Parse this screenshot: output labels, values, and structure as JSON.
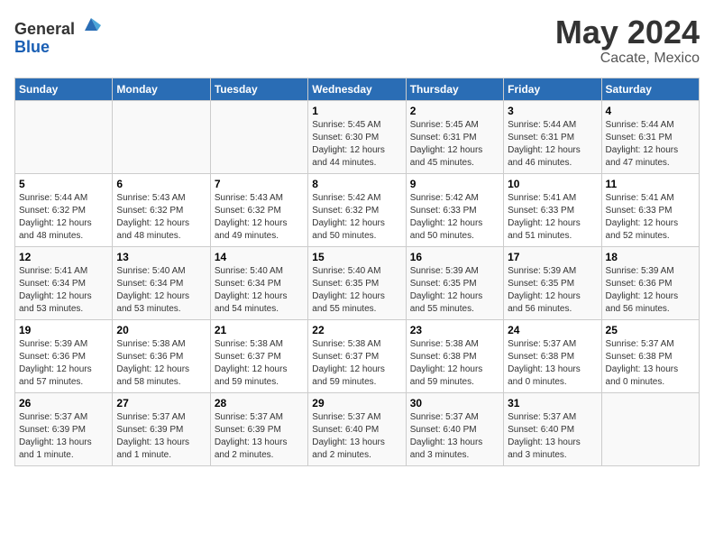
{
  "logo": {
    "text_general": "General",
    "text_blue": "Blue"
  },
  "title": "May 2024",
  "subtitle": "Cacate, Mexico",
  "days_of_week": [
    "Sunday",
    "Monday",
    "Tuesday",
    "Wednesday",
    "Thursday",
    "Friday",
    "Saturday"
  ],
  "weeks": [
    [
      {
        "day": "",
        "info": ""
      },
      {
        "day": "",
        "info": ""
      },
      {
        "day": "",
        "info": ""
      },
      {
        "day": "1",
        "info": "Sunrise: 5:45 AM\nSunset: 6:30 PM\nDaylight: 12 hours and 44 minutes."
      },
      {
        "day": "2",
        "info": "Sunrise: 5:45 AM\nSunset: 6:31 PM\nDaylight: 12 hours and 45 minutes."
      },
      {
        "day": "3",
        "info": "Sunrise: 5:44 AM\nSunset: 6:31 PM\nDaylight: 12 hours and 46 minutes."
      },
      {
        "day": "4",
        "info": "Sunrise: 5:44 AM\nSunset: 6:31 PM\nDaylight: 12 hours and 47 minutes."
      }
    ],
    [
      {
        "day": "5",
        "info": "Sunrise: 5:44 AM\nSunset: 6:32 PM\nDaylight: 12 hours and 48 minutes."
      },
      {
        "day": "6",
        "info": "Sunrise: 5:43 AM\nSunset: 6:32 PM\nDaylight: 12 hours and 48 minutes."
      },
      {
        "day": "7",
        "info": "Sunrise: 5:43 AM\nSunset: 6:32 PM\nDaylight: 12 hours and 49 minutes."
      },
      {
        "day": "8",
        "info": "Sunrise: 5:42 AM\nSunset: 6:32 PM\nDaylight: 12 hours and 50 minutes."
      },
      {
        "day": "9",
        "info": "Sunrise: 5:42 AM\nSunset: 6:33 PM\nDaylight: 12 hours and 50 minutes."
      },
      {
        "day": "10",
        "info": "Sunrise: 5:41 AM\nSunset: 6:33 PM\nDaylight: 12 hours and 51 minutes."
      },
      {
        "day": "11",
        "info": "Sunrise: 5:41 AM\nSunset: 6:33 PM\nDaylight: 12 hours and 52 minutes."
      }
    ],
    [
      {
        "day": "12",
        "info": "Sunrise: 5:41 AM\nSunset: 6:34 PM\nDaylight: 12 hours and 53 minutes."
      },
      {
        "day": "13",
        "info": "Sunrise: 5:40 AM\nSunset: 6:34 PM\nDaylight: 12 hours and 53 minutes."
      },
      {
        "day": "14",
        "info": "Sunrise: 5:40 AM\nSunset: 6:34 PM\nDaylight: 12 hours and 54 minutes."
      },
      {
        "day": "15",
        "info": "Sunrise: 5:40 AM\nSunset: 6:35 PM\nDaylight: 12 hours and 55 minutes."
      },
      {
        "day": "16",
        "info": "Sunrise: 5:39 AM\nSunset: 6:35 PM\nDaylight: 12 hours and 55 minutes."
      },
      {
        "day": "17",
        "info": "Sunrise: 5:39 AM\nSunset: 6:35 PM\nDaylight: 12 hours and 56 minutes."
      },
      {
        "day": "18",
        "info": "Sunrise: 5:39 AM\nSunset: 6:36 PM\nDaylight: 12 hours and 56 minutes."
      }
    ],
    [
      {
        "day": "19",
        "info": "Sunrise: 5:39 AM\nSunset: 6:36 PM\nDaylight: 12 hours and 57 minutes."
      },
      {
        "day": "20",
        "info": "Sunrise: 5:38 AM\nSunset: 6:36 PM\nDaylight: 12 hours and 58 minutes."
      },
      {
        "day": "21",
        "info": "Sunrise: 5:38 AM\nSunset: 6:37 PM\nDaylight: 12 hours and 59 minutes."
      },
      {
        "day": "22",
        "info": "Sunrise: 5:38 AM\nSunset: 6:37 PM\nDaylight: 12 hours and 59 minutes."
      },
      {
        "day": "23",
        "info": "Sunrise: 5:38 AM\nSunset: 6:38 PM\nDaylight: 12 hours and 59 minutes."
      },
      {
        "day": "24",
        "info": "Sunrise: 5:37 AM\nSunset: 6:38 PM\nDaylight: 13 hours and 0 minutes."
      },
      {
        "day": "25",
        "info": "Sunrise: 5:37 AM\nSunset: 6:38 PM\nDaylight: 13 hours and 0 minutes."
      }
    ],
    [
      {
        "day": "26",
        "info": "Sunrise: 5:37 AM\nSunset: 6:39 PM\nDaylight: 13 hours and 1 minute."
      },
      {
        "day": "27",
        "info": "Sunrise: 5:37 AM\nSunset: 6:39 PM\nDaylight: 13 hours and 1 minute."
      },
      {
        "day": "28",
        "info": "Sunrise: 5:37 AM\nSunset: 6:39 PM\nDaylight: 13 hours and 2 minutes."
      },
      {
        "day": "29",
        "info": "Sunrise: 5:37 AM\nSunset: 6:40 PM\nDaylight: 13 hours and 2 minutes."
      },
      {
        "day": "30",
        "info": "Sunrise: 5:37 AM\nSunset: 6:40 PM\nDaylight: 13 hours and 3 minutes."
      },
      {
        "day": "31",
        "info": "Sunrise: 5:37 AM\nSunset: 6:40 PM\nDaylight: 13 hours and 3 minutes."
      },
      {
        "day": "",
        "info": ""
      }
    ]
  ]
}
